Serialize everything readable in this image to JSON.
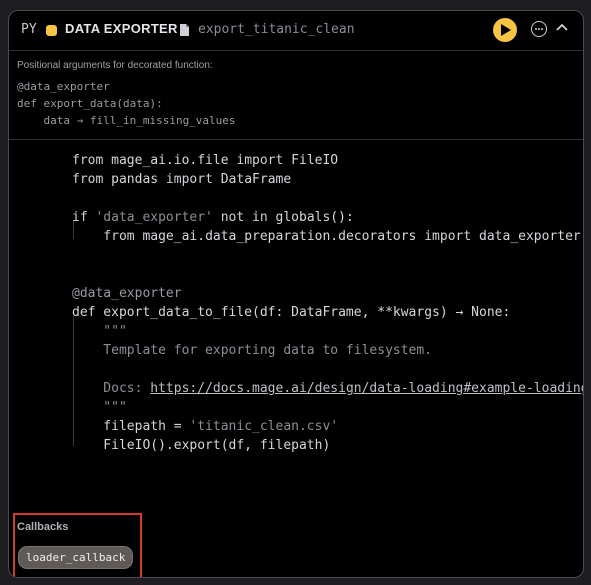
{
  "header": {
    "lang": "PY",
    "block_type": "DATA EXPORTER",
    "file_name": "export_titanic_clean"
  },
  "colors": {
    "accent": "#f6c343",
    "highlight_border": "#d63a2a"
  },
  "positional_args": {
    "label": "Positional arguments for decorated function:",
    "lines": [
      "@data_exporter",
      "def export_data(data):",
      "    data → fill_in_missing_values"
    ]
  },
  "code": {
    "l1": [
      "from ",
      "mage_ai.io.file",
      " import ",
      "FileIO"
    ],
    "l2": [
      "from ",
      "pandas",
      " import ",
      "DataFrame"
    ],
    "l3": [
      "if ",
      "'data_exporter'",
      " not in ",
      "globals():"
    ],
    "l4": [
      "    from ",
      "mage_ai.data_preparation.decorators",
      " import ",
      "data_exporter"
    ],
    "l5": "@data_exporter",
    "l6": "def export_data_to_file(df: DataFrame, **kwargs) → None:",
    "l7": "    \"\"\"",
    "l8": "    Template for exporting data to filesystem.",
    "l9": [
      "    Docs: ",
      "https://docs.mage.ai/design/data-loading#example-loading"
    ],
    "l10": "    \"\"\"",
    "l11": [
      "    filepath = ",
      "'titanic_clean.csv'"
    ],
    "l12": "    FileIO().export(df, filepath)"
  },
  "callbacks": {
    "title": "Callbacks",
    "items": [
      "loader_callback"
    ]
  }
}
